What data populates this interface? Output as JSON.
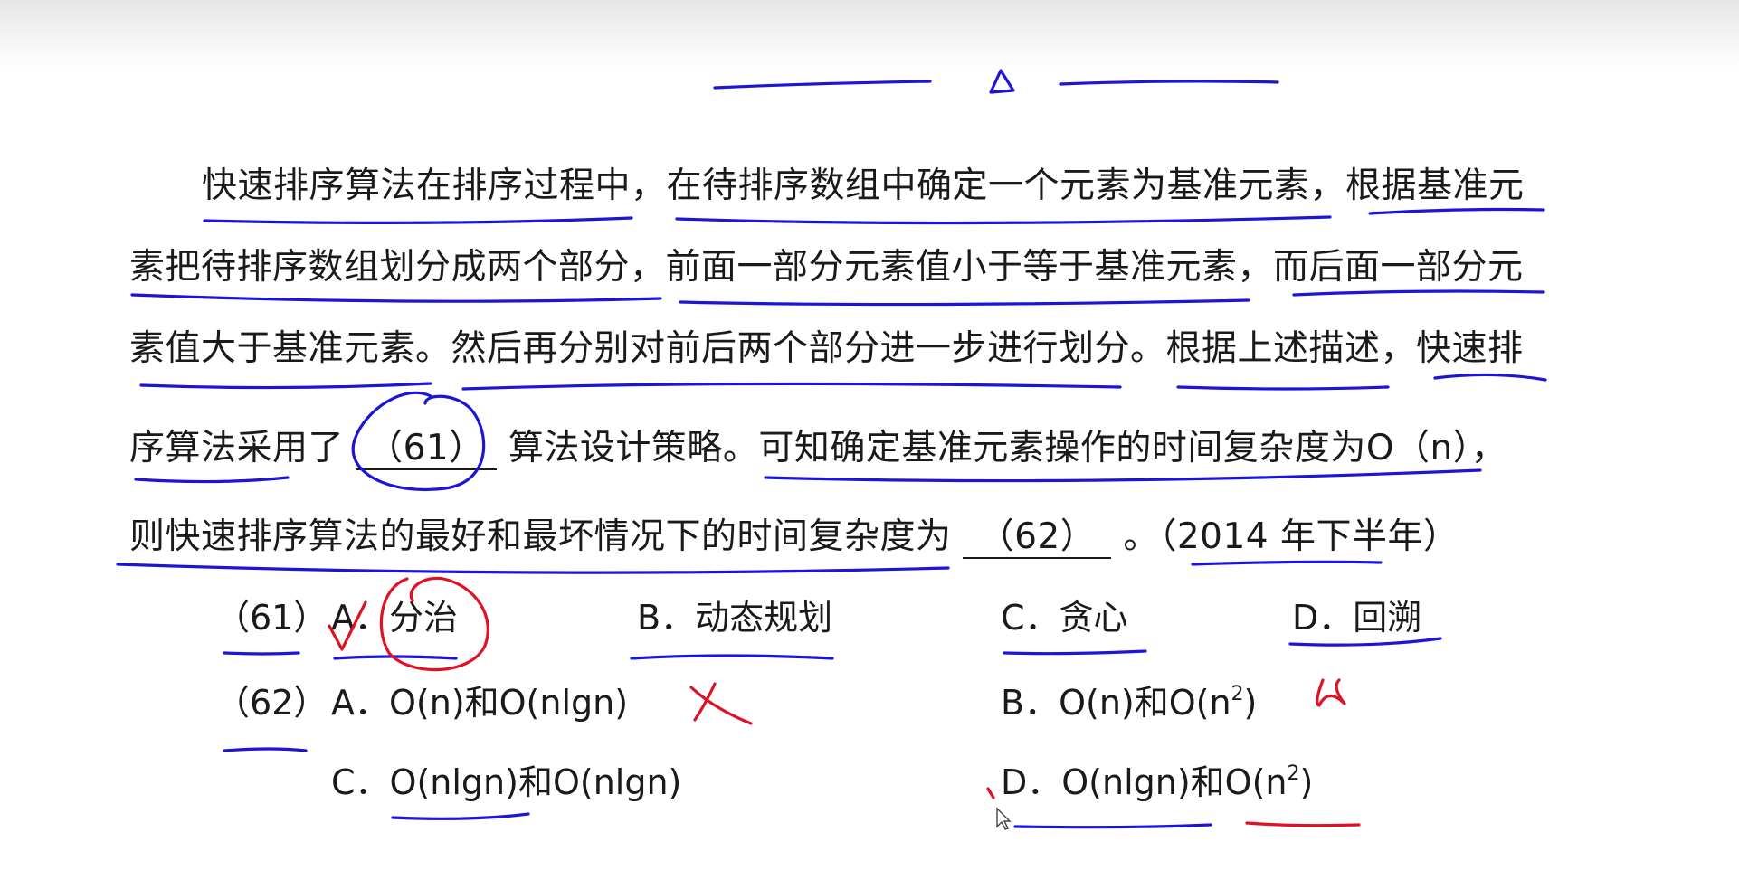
{
  "passage": {
    "line1": "快速排序算法在排序过程中，在待排序数组中确定一个元素为基准元素，根据基准元",
    "line2": "素把待排序数组划分成两个部分，前面一部分元素值小于等于基准元素，而后面一部分元",
    "line3": "素值大于基准元素。然后再分别对前后两个部分进一步进行划分。根据上述描述，快速排",
    "line4_pre": "序算法采用了",
    "blank61": "（61）",
    "line4_post": "算法设计策略。可知确定基准元素操作的时间复杂度为O（n），",
    "line5_pre": "则快速排序算法的最好和最坏情况下的时间复杂度为",
    "blank62": "（62）",
    "line5_post": "。（2014 年下半年）"
  },
  "questions": [
    {
      "number": "（61）",
      "options": [
        {
          "letter": "A．",
          "text": "分治"
        },
        {
          "letter": "B．",
          "text": "动态规划"
        },
        {
          "letter": "C．",
          "text": "贪心"
        },
        {
          "letter": "D．",
          "text": "回溯"
        }
      ]
    },
    {
      "number": "（62）",
      "options": [
        {
          "letter": "A．",
          "text": "O(n)和O(nlgn)"
        },
        {
          "letter": "B．",
          "text_base": "O(n)和O(n",
          "sup": "2",
          "text_tail": ")"
        },
        {
          "letter": "C．",
          "text": "O(nlgn)和O(nlgn)"
        },
        {
          "letter": "D．",
          "text_base": "O(nlgn)和O(n",
          "sup": "2",
          "text_tail": ")"
        }
      ]
    }
  ],
  "annotation_colors": {
    "blue_pen": "#1c14d6",
    "red_pen": "#e01025"
  }
}
